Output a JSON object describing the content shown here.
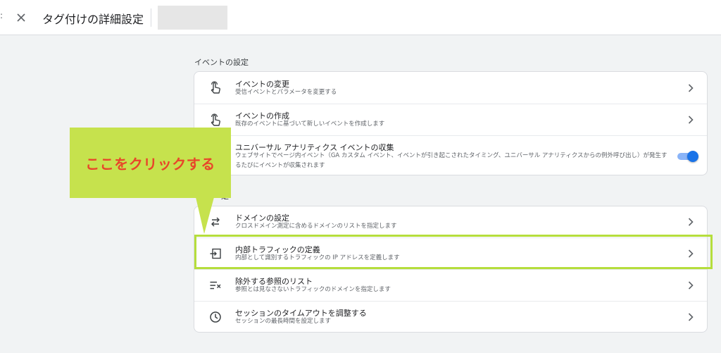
{
  "header": {
    "title": "タグ付けの詳細設定"
  },
  "sections": {
    "events_label": "イベントの設定",
    "other_label_fragment": "定"
  },
  "events": [
    {
      "title": "イベントの変更",
      "desc": "受信イベントとパラメータを変更する",
      "icon": "touch-icon"
    },
    {
      "title": "イベントの作成",
      "desc": "既存のイベントに基づいて新しいイベントを作成します",
      "icon": "touch-icon"
    },
    {
      "title": "ユニバーサル アナリティクス イベントの収集",
      "desc": "ウェブサイトでページ内イベント（GA カスタム イベント、イベントが引き起こされたタイミング、ユニバーサル アナリティクスからの例外呼び出し）が発生するたびにイベントが収集されます",
      "toggle_on": true
    }
  ],
  "settings": [
    {
      "title": "ドメインの設定",
      "desc": "クロスドメイン測定に含めるドメインのリストを指定します",
      "icon": "arrows-icon"
    },
    {
      "title": "内部トラフィックの定義",
      "desc": "内部として識別するトラフィックの IP アドレスを定義します",
      "icon": "login-icon"
    },
    {
      "title": "除外する参照のリスト",
      "desc": "参照とは見なさないトラフィックのドメインを指定します",
      "icon": "filter-list-icon"
    },
    {
      "title": "セッションのタイムアウトを調整する",
      "desc": "セッションの最長時間を設定します",
      "icon": "clock-icon"
    }
  ],
  "annotation": {
    "callout_text": "ここをクリックする",
    "callout_color": "#c6e24d",
    "text_color": "#e8462a",
    "highlight_color": "#b5de3c"
  },
  "colors": {
    "toggle_on": "#1a73e8",
    "background": "#f1f3f4"
  }
}
